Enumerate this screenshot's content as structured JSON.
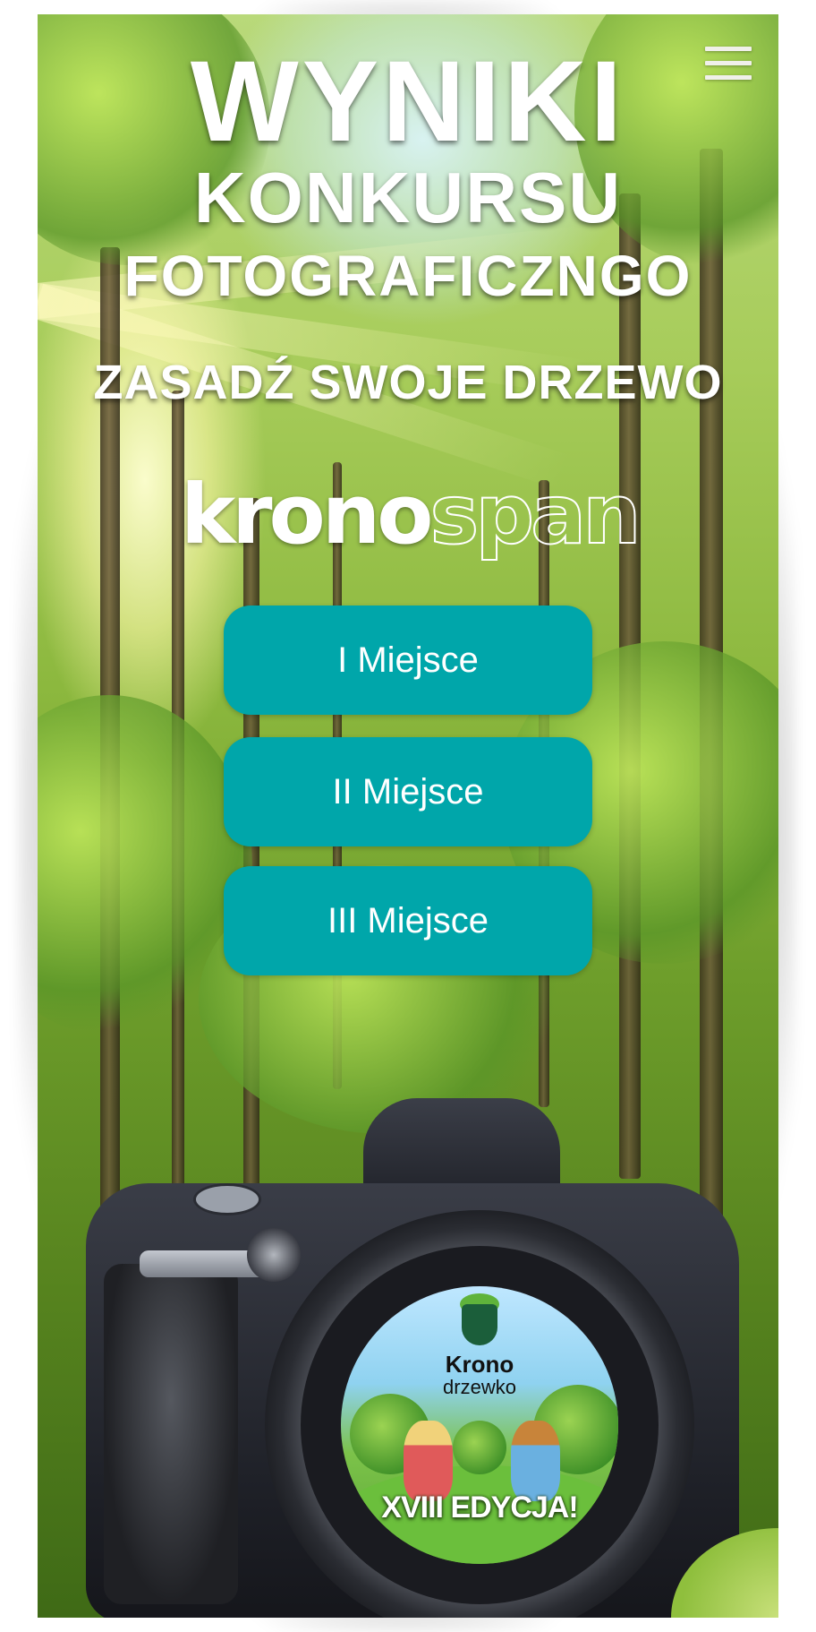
{
  "menu": {
    "icon": "hamburger-menu-icon"
  },
  "header": {
    "line1": "WYNIKI",
    "line2": "KONKURSU",
    "line3": "FOTOGRAFICZNGO",
    "line4": "ZASADŹ SWOJE DRZEWO"
  },
  "brand": {
    "solid": "krono",
    "outline": "span"
  },
  "buttons": [
    {
      "label": "I Miejsce"
    },
    {
      "label": "II Miejsce"
    },
    {
      "label": "III Miejsce"
    }
  ],
  "lens": {
    "title": "Krono",
    "subtitle": "drzewko",
    "edition": "XVIII EDYCJA!"
  },
  "colors": {
    "button": "#00a6aa",
    "text": "#ffffff"
  }
}
